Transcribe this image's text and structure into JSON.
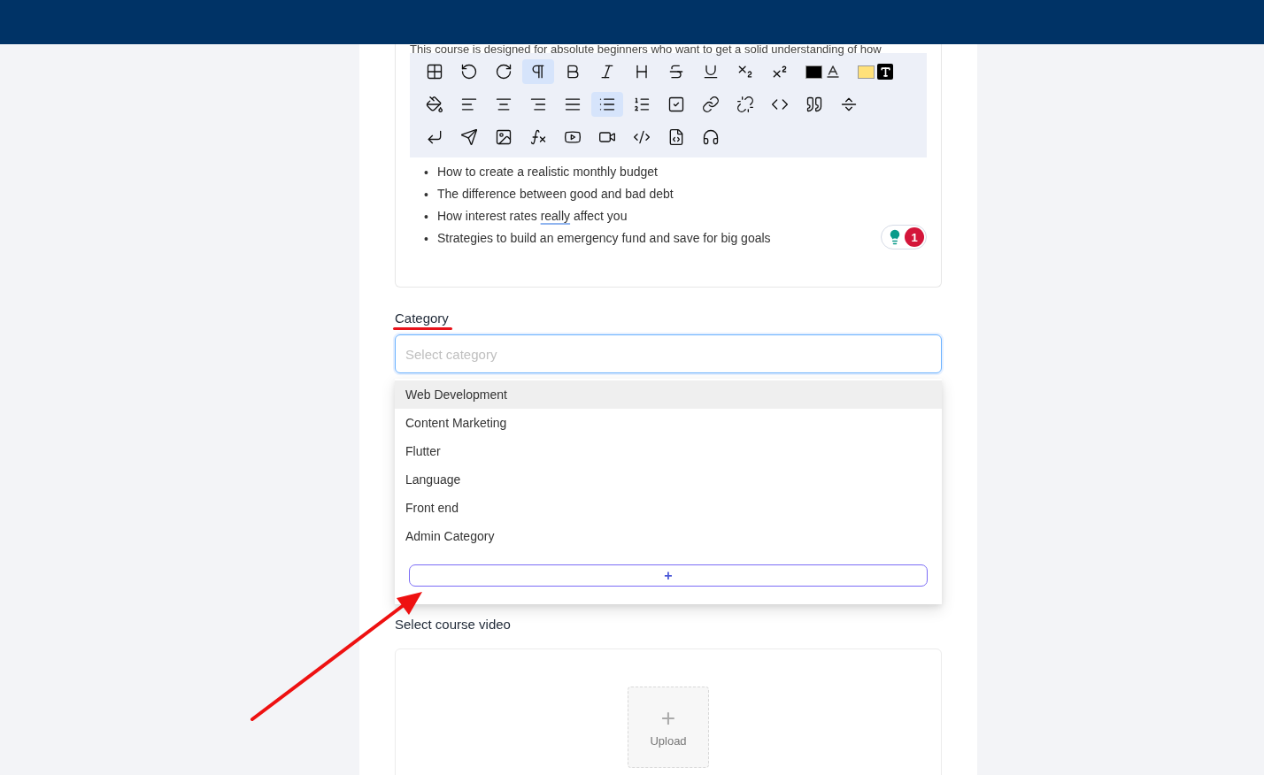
{
  "description_excerpt": "This course is designed for absolute beginners who want to get a solid understanding of how",
  "toolbar": {
    "rows": [
      [
        {
          "kind": "button",
          "selected": false
        },
        {
          "kind": "button",
          "selected": false
        },
        {
          "kind": "button",
          "selected": false
        },
        {
          "kind": "button",
          "selected": true
        },
        {
          "kind": "button",
          "selected": false
        },
        {
          "kind": "button",
          "selected": false
        },
        {
          "kind": "button",
          "selected": false
        },
        {
          "kind": "button",
          "selected": false
        },
        {
          "kind": "button",
          "selected": false
        },
        {
          "kind": "button",
          "selected": false
        },
        {
          "kind": "button",
          "selected": false
        },
        {
          "kind": "swatch",
          "color": "#000000",
          "selected": false
        },
        {
          "kind": "swatch",
          "color": "#ffe17a",
          "selected": false
        }
      ],
      [
        {
          "kind": "button",
          "selected": false
        },
        {
          "kind": "button",
          "selected": false
        },
        {
          "kind": "button",
          "selected": false
        },
        {
          "kind": "button",
          "selected": false
        },
        {
          "kind": "button",
          "selected": false
        },
        {
          "kind": "button",
          "selected": true
        },
        {
          "kind": "button",
          "selected": false
        },
        {
          "kind": "button",
          "selected": false
        },
        {
          "kind": "button",
          "selected": false
        },
        {
          "kind": "button",
          "selected": false
        },
        {
          "kind": "button",
          "selected": false
        },
        {
          "kind": "button",
          "selected": false
        },
        {
          "kind": "button",
          "selected": false
        }
      ],
      [
        {
          "kind": "button",
          "selected": false
        },
        {
          "kind": "button",
          "selected": false
        },
        {
          "kind": "button",
          "selected": false
        },
        {
          "kind": "button",
          "selected": false
        },
        {
          "kind": "button",
          "selected": false
        },
        {
          "kind": "button",
          "selected": false
        },
        {
          "kind": "button",
          "selected": false
        },
        {
          "kind": "button",
          "selected": false
        },
        {
          "kind": "button",
          "selected": false
        }
      ]
    ]
  },
  "bullets": [
    {
      "marker": "•",
      "segments": [
        {
          "text": "How to create a realistic monthly budget",
          "flagged": false
        }
      ]
    },
    {
      "marker": "•",
      "segments": [
        {
          "text": "The difference between good and bad debt",
          "flagged": false
        }
      ]
    },
    {
      "marker": "•",
      "segments": [
        {
          "text": "How interest rates ",
          "flagged": false
        },
        {
          "text": "really",
          "flagged": true
        },
        {
          "text": " affect you",
          "flagged": false
        }
      ]
    },
    {
      "marker": "•",
      "segments": [
        {
          "text": "Strategies to build an emergency fund and save for big goals",
          "flagged": false
        }
      ]
    }
  ],
  "assistant_badge": {
    "count": "1"
  },
  "category": {
    "label": "Category",
    "placeholder": "Select category",
    "focused": true,
    "options": [
      {
        "label": "Web Development",
        "selected": true
      },
      {
        "label": "Content Marketing",
        "selected": false
      },
      {
        "label": "Flutter",
        "selected": false
      },
      {
        "label": "Language",
        "selected": false
      },
      {
        "label": "Front end",
        "selected": false
      },
      {
        "label": "Admin Category",
        "selected": false
      }
    ],
    "add_button": "+"
  },
  "video": {
    "label": "Select course video",
    "upload_icon": "+",
    "upload_label": "Upload"
  },
  "annotations": {
    "label_underline": true,
    "pointer_arrow": true
  }
}
